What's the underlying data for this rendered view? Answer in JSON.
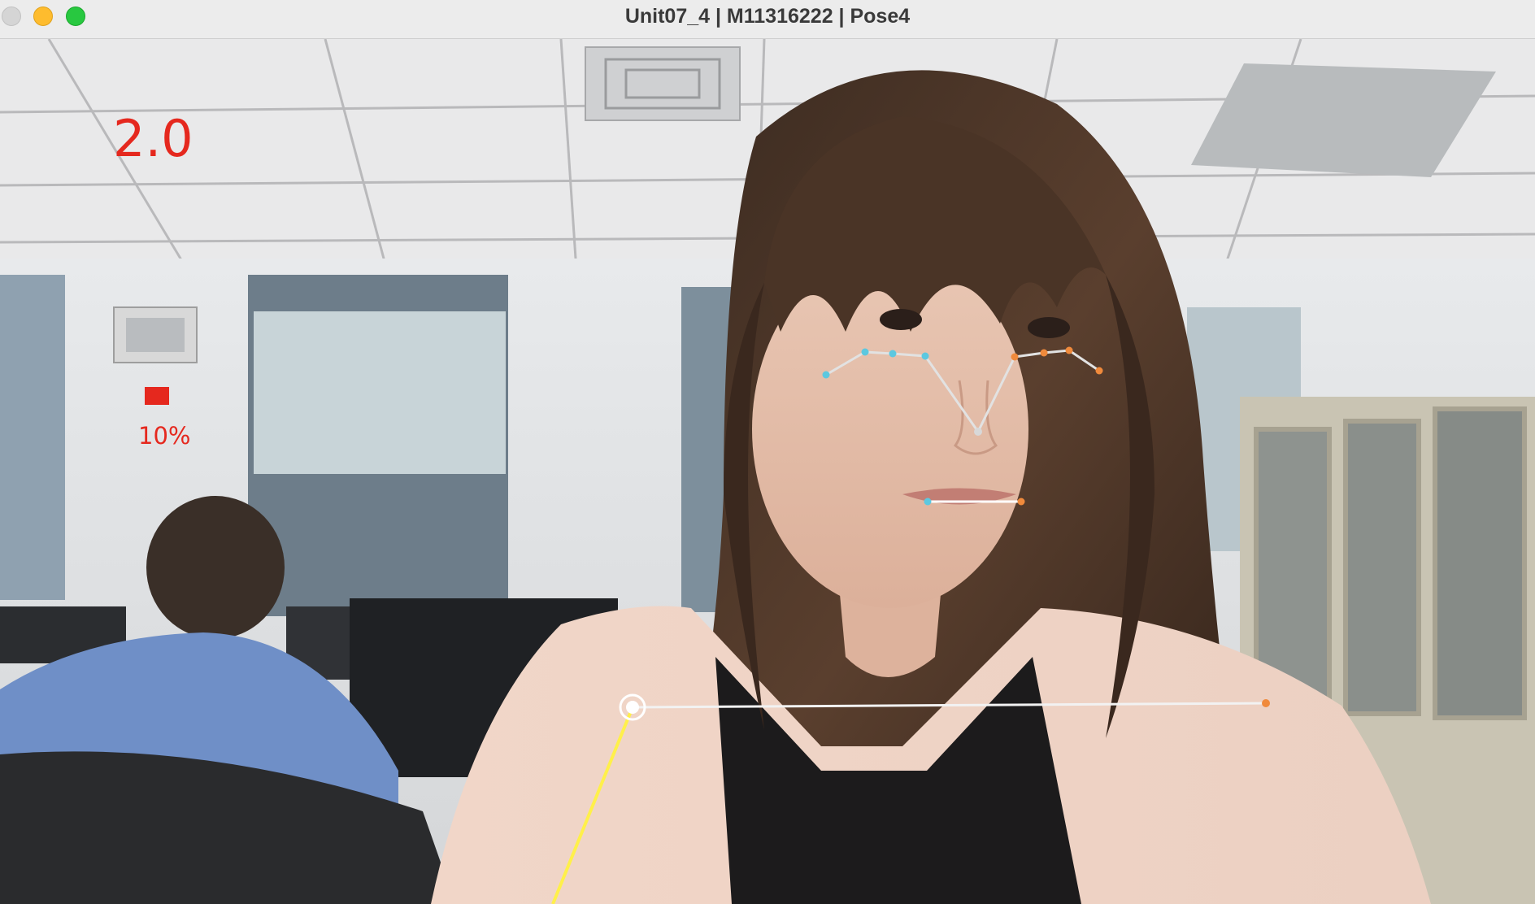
{
  "window": {
    "title": "Unit07_4 | M11316222 | Pose4"
  },
  "overlay": {
    "score": "2.0",
    "percent": "10%",
    "level_fraction": 0.1
  },
  "colors": {
    "overlay_text": "#e5281e",
    "left_landmarks": "#5cc8e0",
    "right_landmarks": "#f08a3c",
    "pose_line": "#ffffff",
    "arm_line": "#ffe83a"
  },
  "icons": {
    "close": "traffic-close",
    "minimize": "traffic-minimize",
    "maximize": "traffic-maximize"
  }
}
